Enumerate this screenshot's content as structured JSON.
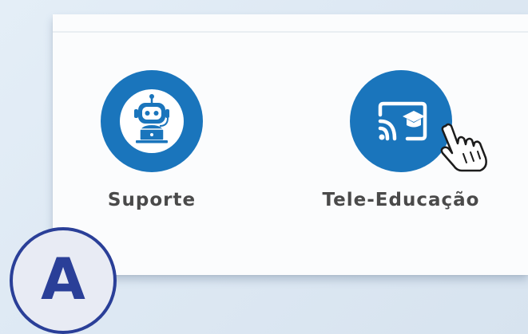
{
  "tiles": [
    {
      "label": "Suporte",
      "icon": "robot-support-icon"
    },
    {
      "label": "Tele-Educação",
      "icon": "cast-education-icon"
    }
  ],
  "badge": {
    "letter": "A"
  },
  "colors": {
    "tile_circle": "#1a75bc",
    "badge_border": "#2a3f98",
    "label_text": "#4a4a4a"
  }
}
